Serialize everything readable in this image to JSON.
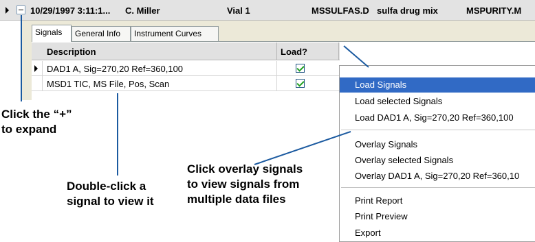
{
  "top_row": {
    "datetime": "10/29/1997 3:11:1...",
    "operator": "C. Miller",
    "vial": "Vial 1",
    "datafile": "MSSULFAS.D",
    "sample": "sulfa drug mix",
    "method": "MSPURITY.M"
  },
  "tabs": [
    "Signals",
    "General Info",
    "Instrument Curves"
  ],
  "grid": {
    "headers": {
      "description": "Description",
      "load": "Load?"
    },
    "rows": [
      {
        "description": "DAD1 A, Sig=270,20 Ref=360,100",
        "load": true
      },
      {
        "description": "MSD1 TIC, MS File, Pos, Scan",
        "load": true
      }
    ]
  },
  "context_menu": {
    "highlighted": "Load Signals",
    "items": [
      "Load Signals",
      "Load selected Signals",
      "Load DAD1 A, Sig=270,20 Ref=360,100",
      "Overlay Signals",
      "Overlay selected Signals",
      "Overlay DAD1 A, Sig=270,20 Ref=360,10",
      "Print Report",
      "Print Preview",
      "Export"
    ]
  },
  "annotations": {
    "expand_line1": "Click the “+”",
    "expand_line2": "to expand",
    "double_line1": "Double-click a",
    "double_line2": "signal to view it",
    "overlay_line1": "Click overlay signals",
    "overlay_line2": "to view signals from",
    "overlay_line3": "multiple data files"
  },
  "colors": {
    "menu_highlight": "#316ac5",
    "leader_line": "#1b5aa0",
    "checkmark": "#21a121"
  }
}
